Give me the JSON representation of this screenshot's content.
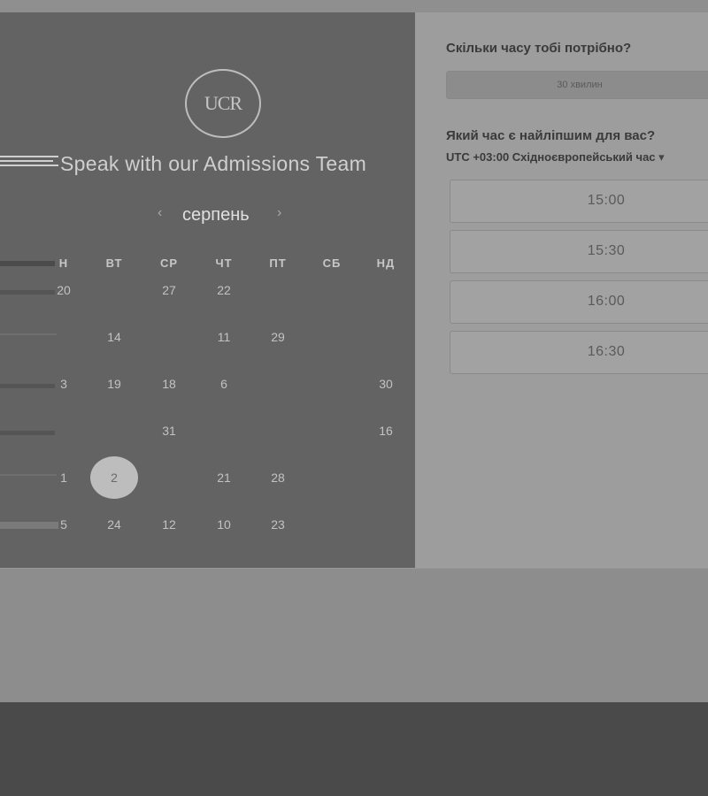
{
  "scheduler": {
    "title": "Speak with our Admissions Team",
    "logo_text": "UCR",
    "month": "серпень",
    "weekdays": [
      "Н",
      "ВТ",
      "СР",
      "ЧТ",
      "ПТ",
      "СБ",
      "НД"
    ],
    "weeks": [
      [
        "20",
        "",
        "27",
        "22",
        "",
        "",
        ""
      ],
      [
        "",
        "14",
        "",
        "11",
        "29",
        "",
        ""
      ],
      [
        "3",
        "19",
        "18",
        "6",
        "",
        "",
        "30"
      ],
      [
        "",
        "",
        "31",
        "",
        "",
        "",
        "16"
      ],
      [
        "1",
        "2",
        "",
        "21",
        "28",
        "",
        ""
      ],
      [
        "5",
        "24",
        "12",
        "10",
        "23",
        "",
        ""
      ]
    ],
    "selected_day": "2"
  },
  "booking": {
    "duration_question": "Скільки часу тобі потрібно?",
    "duration_value": "30 хвилин",
    "time_question": "Який час є найліпшим для вас?",
    "timezone_offset": "UTC +03:00",
    "timezone_name": "Східноєвропейський час",
    "slots": [
      "15:00",
      "15:30",
      "16:00",
      "16:30"
    ]
  }
}
